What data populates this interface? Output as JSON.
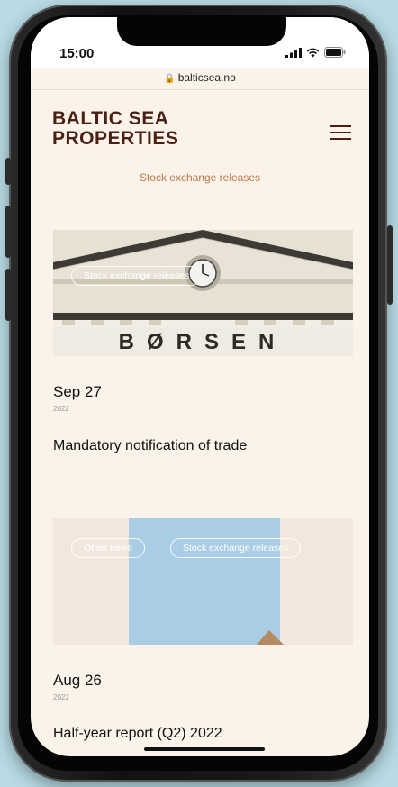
{
  "status_bar": {
    "time": "15:00",
    "signal_icon": "cellular-signal-icon",
    "wifi_icon": "wifi-icon",
    "battery_icon": "battery-icon"
  },
  "browser": {
    "url": "balticsea.no",
    "lock_icon": "lock-icon"
  },
  "header": {
    "brand_line1": "BALTIC SEA",
    "brand_line2": "PROPERTIES",
    "menu_icon": "hamburger-menu-icon"
  },
  "page": {
    "section_title": "Stock exchange releases"
  },
  "articles": [
    {
      "tags": [
        "Stock exchange releases"
      ],
      "image_text": "BØRSEN",
      "date": "Sep 27",
      "year": "2022",
      "title": "Mandatory notification of trade"
    },
    {
      "tags": [
        "Other news",
        "Stock exchange releases"
      ],
      "date": "Aug 26",
      "year": "2022",
      "title": "Half-year report (Q2) 2022"
    }
  ],
  "colors": {
    "brand": "#4a1f14",
    "accent": "#b87a4a",
    "page_bg": "#fbf3ea",
    "outer_bg": "#b8dbe4",
    "image_blue": "#a9cde4"
  }
}
